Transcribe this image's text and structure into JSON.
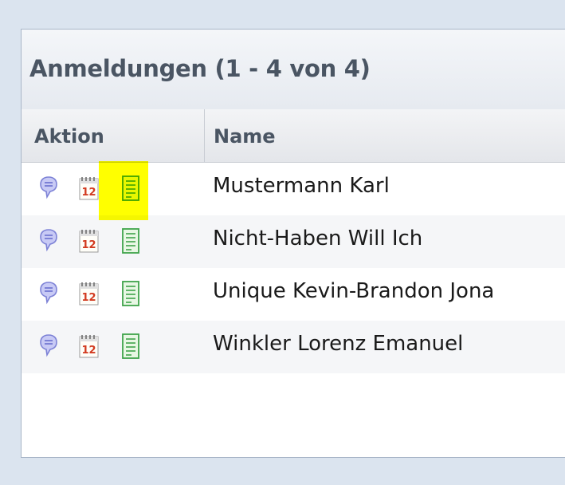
{
  "panel": {
    "title": "Anmeldungen (1 - 4 von 4)"
  },
  "columns": {
    "aktion": "Aktion",
    "name": "Name"
  },
  "rows": [
    {
      "name": "Mustermann Karl",
      "highlighted": true,
      "struck": true
    },
    {
      "name": "Nicht-Haben Will Ich"
    },
    {
      "name": "Unique Kevin-Brandon Jona"
    },
    {
      "name": "Winkler Lorenz Emanuel"
    }
  ],
  "calendar_icon_day": "12",
  "icons": [
    "speech-bubble-icon",
    "calendar-icon",
    "document-icon"
  ],
  "colors": {
    "highlight": "#ffff00",
    "strike": "#b5453f",
    "bubble": "#8a8fe0",
    "document": "#3fa34a",
    "calendar": "#d23a1f"
  }
}
